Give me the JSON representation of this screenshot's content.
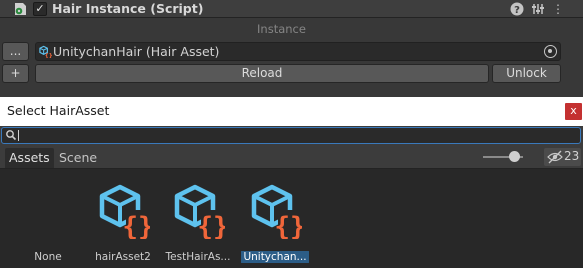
{
  "component": {
    "title": "Hair Instance (Script)",
    "enabled_glyph": "✓",
    "icons": [
      "script-gear-icon",
      "help-icon",
      "presets-icon",
      "more-menu-icon"
    ],
    "help_glyph": "?",
    "presets_glyph": "⇅",
    "menu_glyph": "⋮"
  },
  "instance": {
    "section_label": "Instance",
    "dots_button": "...",
    "asset_field_value": "UnitychanHair (Hair Asset)",
    "plus_button": "+",
    "reload_button": "Reload",
    "unlock_button": "Unlock"
  },
  "picker": {
    "title": "Select HairAsset",
    "close_glyph": "x",
    "search_value": "",
    "tabs": [
      {
        "label": "Assets",
        "active": true
      },
      {
        "label": "Scene",
        "active": false
      }
    ],
    "hidden_count": "23",
    "items": [
      {
        "label": "None",
        "selected": false,
        "has_icon": false
      },
      {
        "label": "hairAsset2",
        "selected": false,
        "has_icon": true
      },
      {
        "label": "TestHairAs...",
        "selected": false,
        "has_icon": true
      },
      {
        "label": "Unitychan...",
        "selected": true,
        "has_icon": true
      }
    ]
  },
  "colors": {
    "asset_icon_blue": "#5ec2ee",
    "asset_icon_orange": "#f0663a",
    "selection": "#2c5d87",
    "close_red": "#c43131",
    "focus_blue": "#3a79bb"
  }
}
